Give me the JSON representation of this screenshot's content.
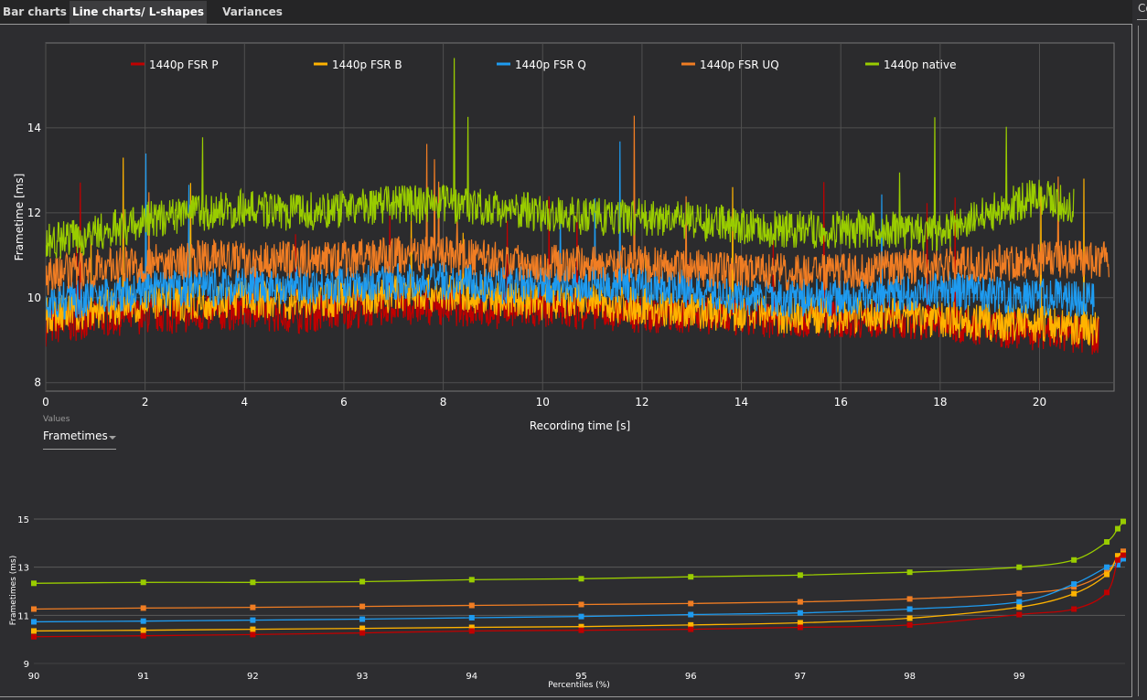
{
  "tabs": [
    {
      "label": "Bar charts",
      "active": false
    },
    {
      "label": "Line charts/ L-shapes",
      "active": true
    },
    {
      "label": "Variances",
      "active": false
    }
  ],
  "right_panel": {
    "title_fragment": "Co"
  },
  "values_selector": {
    "label": "Values",
    "selected": "Frametimes"
  },
  "colors": {
    "background": "#2d2d30",
    "grid": "#505050",
    "series": [
      "#c00000",
      "#ffb300",
      "#1e9bf0",
      "#f07d23",
      "#99cc00"
    ]
  },
  "chart_data": [
    {
      "type": "line",
      "title": "",
      "xlabel": "Recording time [s]",
      "ylabel": "Frametime [ms]",
      "xlim": [
        0,
        21.5
      ],
      "ylim": [
        7.8,
        16
      ],
      "xticks": [
        0,
        2,
        4,
        6,
        8,
        10,
        12,
        14,
        16,
        18,
        20
      ],
      "yticks": [
        8,
        10,
        12,
        14
      ],
      "grid": true,
      "legend": "top",
      "x": [
        0,
        1,
        2,
        3,
        4,
        5,
        6,
        7,
        8,
        9,
        10,
        11,
        12,
        13,
        14,
        15,
        16,
        17,
        18,
        19,
        20,
        21
      ],
      "series": [
        {
          "name": "1440p FSR P",
          "color": "#c00000",
          "end": 21.2,
          "values": [
            9.3,
            9.5,
            9.6,
            9.6,
            9.7,
            9.6,
            9.7,
            9.8,
            9.8,
            9.7,
            9.7,
            9.7,
            9.6,
            9.6,
            9.5,
            9.5,
            9.5,
            9.5,
            9.4,
            9.3,
            9.2,
            9.1
          ]
        },
        {
          "name": "1440p FSR B",
          "color": "#ffb300",
          "end": 21.2,
          "values": [
            9.6,
            9.7,
            9.9,
            9.9,
            10.0,
            9.9,
            10.0,
            10.1,
            10.1,
            10.0,
            9.9,
            9.9,
            9.8,
            9.7,
            9.6,
            9.6,
            9.6,
            9.6,
            9.5,
            9.4,
            9.4,
            9.3
          ]
        },
        {
          "name": "1440p FSR Q",
          "color": "#1e9bf0",
          "end": 21.1,
          "values": [
            9.9,
            10.0,
            10.2,
            10.2,
            10.3,
            10.3,
            10.3,
            10.4,
            10.4,
            10.3,
            10.3,
            10.3,
            10.3,
            10.2,
            10.0,
            10.0,
            10.0,
            10.1,
            10.2,
            10.1,
            10.0,
            10.0
          ]
        },
        {
          "name": "1440p FSR UQ",
          "color": "#f07d23",
          "end": 21.4,
          "values": [
            10.5,
            10.7,
            10.8,
            10.9,
            10.9,
            10.9,
            10.9,
            11.0,
            11.0,
            10.9,
            10.8,
            10.8,
            10.8,
            10.7,
            10.6,
            10.6,
            10.6,
            10.7,
            10.8,
            10.8,
            10.9,
            10.9
          ]
        },
        {
          "name": "1440p native",
          "color": "#99cc00",
          "end": 20.7,
          "values": [
            11.3,
            11.5,
            11.8,
            12.0,
            12.1,
            12.0,
            12.1,
            12.2,
            12.2,
            12.1,
            12.0,
            11.9,
            11.9,
            11.8,
            11.7,
            11.6,
            11.6,
            11.6,
            11.5,
            12.0,
            12.4,
            12.0
          ]
        }
      ]
    },
    {
      "type": "line",
      "title": "",
      "xlabel": "Percentiles (%)",
      "ylabel": "Frametimes (ms)",
      "xlim": [
        90,
        100
      ],
      "ylim": [
        9,
        15
      ],
      "xticks": [
        90,
        91,
        92,
        93,
        94,
        95,
        96,
        97,
        98,
        99
      ],
      "yticks": [
        9,
        11,
        13,
        15
      ],
      "grid": true,
      "markers": "square",
      "x": [
        90,
        91,
        92,
        93,
        94,
        95,
        96,
        97,
        98,
        99,
        99.5,
        99.8,
        99.9,
        99.95
      ],
      "series": [
        {
          "color": "#99cc00",
          "values": [
            12.33,
            12.37,
            12.37,
            12.4,
            12.48,
            12.52,
            12.6,
            12.67,
            12.79,
            13.0,
            13.3,
            14.05,
            14.6,
            14.9
          ]
        },
        {
          "color": "#f07d23",
          "values": [
            11.26,
            11.3,
            11.33,
            11.37,
            11.41,
            11.45,
            11.49,
            11.56,
            11.68,
            11.9,
            12.18,
            12.82,
            13.47,
            13.66
          ]
        },
        {
          "color": "#1e9bf0",
          "values": [
            10.73,
            10.76,
            10.8,
            10.84,
            10.9,
            10.95,
            11.03,
            11.1,
            11.26,
            11.56,
            12.3,
            13.0,
            13.1,
            13.35
          ]
        },
        {
          "color": "#ffb300",
          "values": [
            10.35,
            10.38,
            10.42,
            10.46,
            10.5,
            10.53,
            10.6,
            10.69,
            10.88,
            11.34,
            11.9,
            12.7,
            13.47,
            13.55
          ]
        },
        {
          "color": "#c00000",
          "values": [
            10.11,
            10.15,
            10.2,
            10.27,
            10.35,
            10.38,
            10.42,
            10.5,
            10.6,
            11.03,
            11.26,
            11.95,
            13.3,
            13.5
          ]
        }
      ]
    }
  ]
}
